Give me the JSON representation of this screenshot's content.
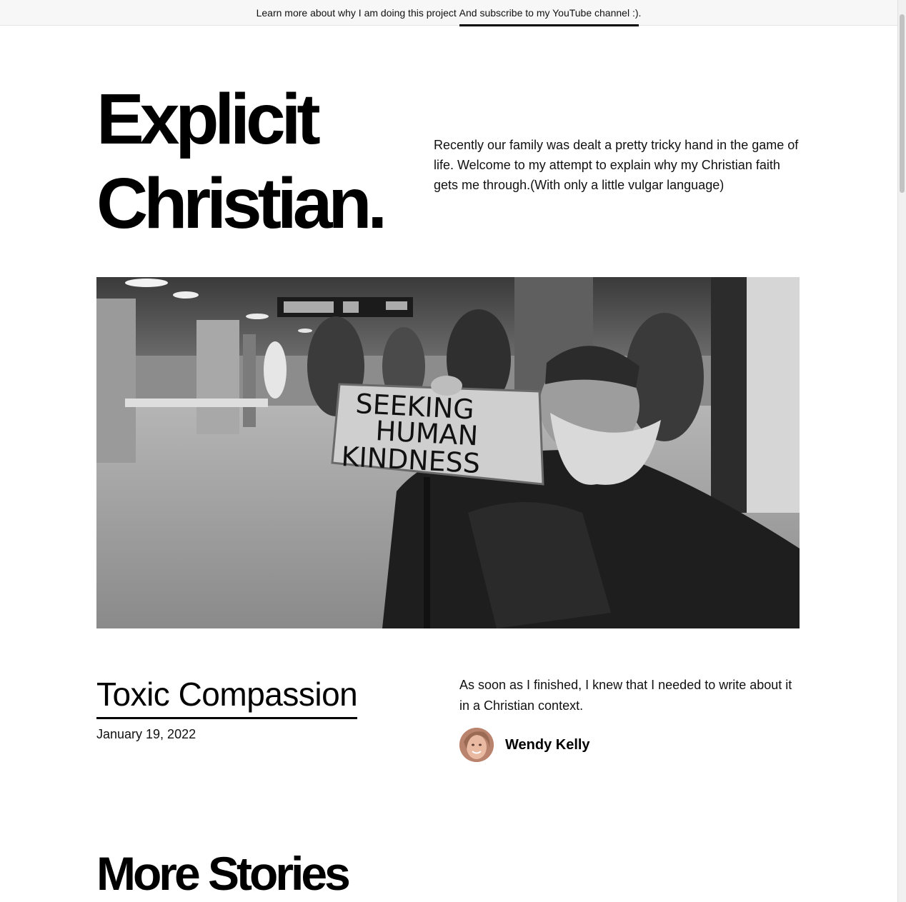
{
  "announcement": {
    "text_before": "Learn more about why I am doing this project ",
    "link_text": "And subscribe to my YouTube channel :)",
    "text_after": "."
  },
  "site": {
    "title_line1": "Explicit",
    "title_line2": "Christian.",
    "description": "Recently our family was dealt a pretty tricky hand in the game of life. Welcome to my attempt to explain why my Christian faith gets me through.(With only a little vulgar language)"
  },
  "featured_image": {
    "sign_line1": "SEEKING",
    "sign_line2": "HUMAN",
    "sign_line3": "KINDNESS"
  },
  "post": {
    "title": "Toxic Compassion",
    "date": "January 19, 2022",
    "excerpt": "As soon as I finished, I knew that I needed to write about it in a Christian context.",
    "author_name": "Wendy Kelly"
  },
  "more_stories": {
    "heading": "More Stories"
  },
  "colors": {
    "background": "#ffffff",
    "text": "#000000",
    "topbar_bg": "#f7f7f7"
  }
}
